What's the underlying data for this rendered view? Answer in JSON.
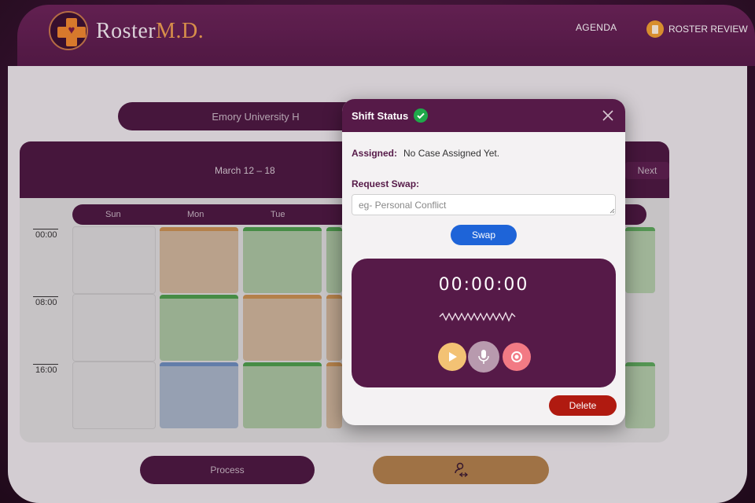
{
  "header": {
    "brand_main": "Roster",
    "brand_accent": "M.D.",
    "nav_agenda": "AGENDA",
    "nav_review": "ROSTER REVIEW"
  },
  "main": {
    "hospital": "Emory University H",
    "week": "March 12 – 18",
    "next": "Next",
    "days": [
      "Sun",
      "Mon",
      "Tue"
    ],
    "times": [
      "00:00",
      "08:00",
      "16:00"
    ],
    "process_label": "Process"
  },
  "modal": {
    "title": "Shift Status",
    "assigned_label": "Assigned:",
    "assigned_value": "No Case Assigned Yet.",
    "swap_label": "Request Swap:",
    "swap_placeholder": "eg- Personal Conflict",
    "swap_button": "Swap",
    "timer": "00:00:00",
    "delete_button": "Delete"
  },
  "colors": {
    "brand_purple": "#561a48",
    "accent_orange": "#f0882e",
    "swap_blue": "#1e64d8",
    "delete_red": "#b01a10",
    "status_green": "#1fa84a"
  },
  "icons": [
    "logo-cross-heart-icon",
    "roster-review-icon",
    "check-circle-icon",
    "close-icon",
    "play-icon",
    "microphone-icon",
    "stop-icon",
    "user-swap-icon",
    "waveform-icon"
  ]
}
